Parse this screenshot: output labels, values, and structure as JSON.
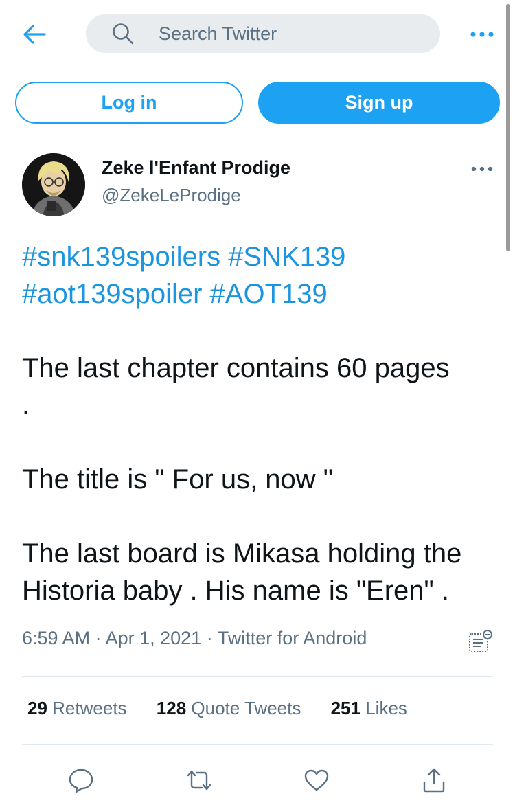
{
  "header": {
    "search_placeholder": "Search Twitter"
  },
  "auth": {
    "login_label": "Log in",
    "signup_label": "Sign up"
  },
  "tweet": {
    "author_name": "Zeke l'Enfant Prodige",
    "author_handle": "@ZekeLeProdige",
    "hashtags_line1": [
      "#snk139spoilers",
      "#SNK139"
    ],
    "hashtags_line2": [
      "#aot139spoiler",
      "#AOT139"
    ],
    "body_lines": [
      "The last chapter contains 60 pages",
      ".",
      "The title is \" For us, now \"",
      "The last board is Mikasa holding the",
      "Historia baby . His name is \"Eren\" ."
    ],
    "time": "6:59 AM",
    "date": "Apr 1, 2021",
    "source": "Twitter for Android",
    "separator": "·"
  },
  "stats": {
    "retweets_count": "29",
    "retweets_label": "Retweets",
    "quote_count": "128",
    "quote_label": "Quote Tweets",
    "likes_count": "251",
    "likes_label": "Likes"
  },
  "icons": {
    "accent": "#1da1f2",
    "muted": "#5b7083"
  }
}
